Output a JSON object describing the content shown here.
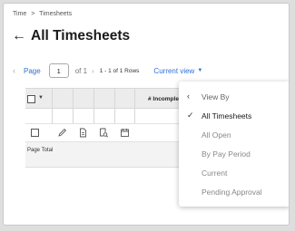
{
  "breadcrumb": {
    "root": "Time",
    "separator": ">",
    "current": "Timesheets"
  },
  "page": {
    "title": "All Timesheets",
    "back_icon": "arrow-left-icon"
  },
  "pager": {
    "page_label": "Page",
    "page_value": "1",
    "of_text": "of 1",
    "rows_text": "1 - 1 of 1 Rows",
    "current_view_label": "Current view"
  },
  "grid": {
    "column_title": "# Incomple",
    "row_icons": [
      "pencil-icon",
      "document-icon",
      "search-document-icon",
      "calendar-icon"
    ],
    "total_label": "Page Total"
  },
  "view_menu": {
    "header": "View By",
    "items": [
      {
        "label": "All Timesheets",
        "selected": true
      },
      {
        "label": "All Open",
        "selected": false
      },
      {
        "label": "By Pay Period",
        "selected": false
      },
      {
        "label": "Current",
        "selected": false
      },
      {
        "label": "Pending Approval",
        "selected": false
      }
    ]
  },
  "colors": {
    "accent": "#2f6fd6",
    "header_bg": "#ececec",
    "page_bg": "#dedede"
  }
}
